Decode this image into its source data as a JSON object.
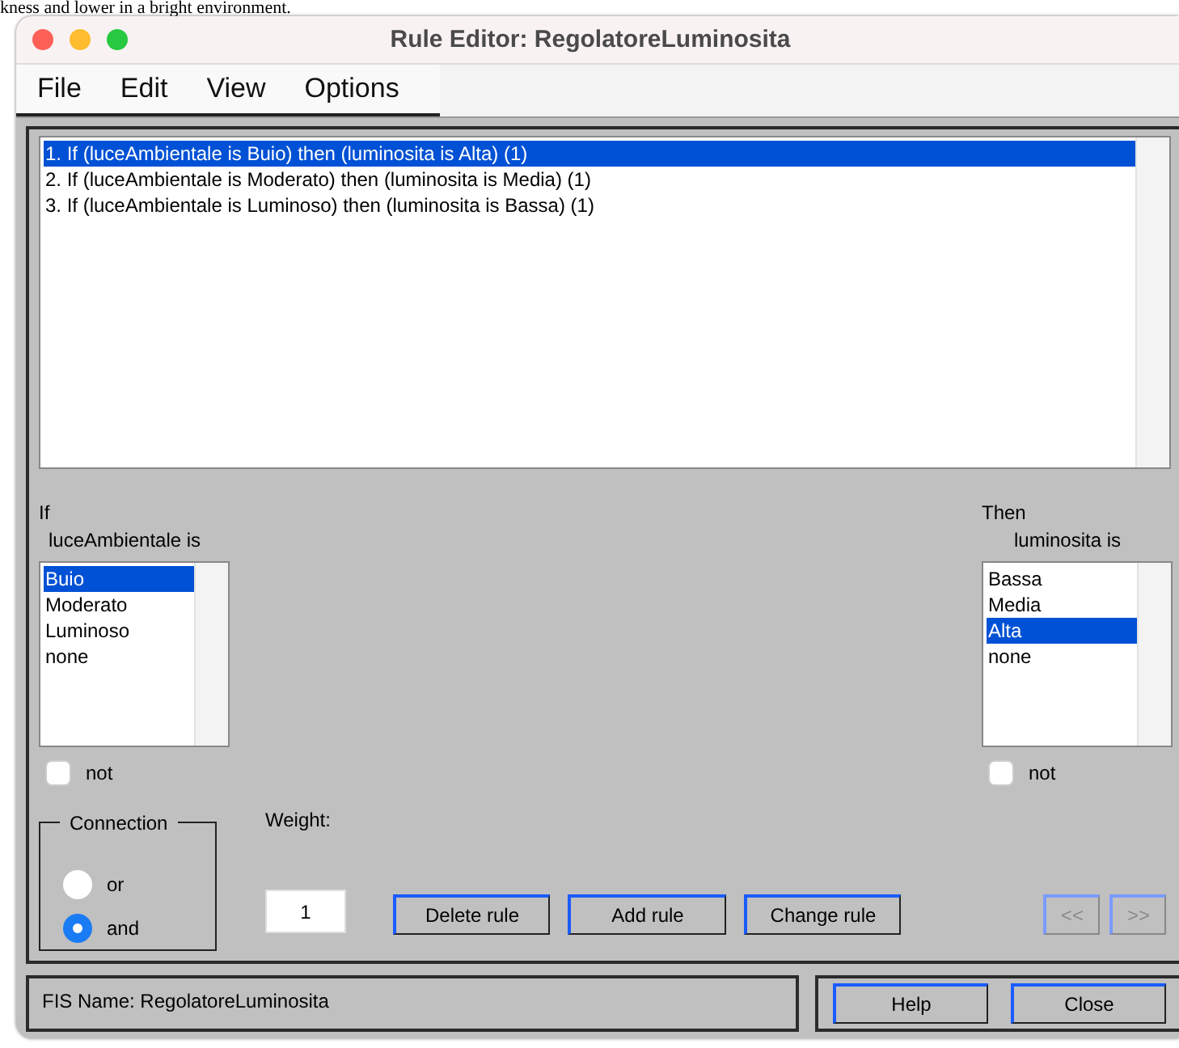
{
  "background_text": "kness and lower in a bright environment.",
  "window": {
    "title": "Rule Editor: RegolatoreLuminosita"
  },
  "menu": [
    "File",
    "Edit",
    "View",
    "Options"
  ],
  "rules": [
    {
      "text": "1. If (luceAmbientale is Buio) then (luminosita is Alta) (1)",
      "selected": true
    },
    {
      "text": "2. If (luceAmbientale is Moderato) then (luminosita is Media) (1)",
      "selected": false
    },
    {
      "text": "3. If (luceAmbientale is Luminoso) then (luminosita is Bassa) (1)",
      "selected": false
    }
  ],
  "if_section": {
    "heading": "If",
    "variable_label": "luceAmbientale is",
    "options": [
      {
        "label": "Buio",
        "selected": true
      },
      {
        "label": "Moderato",
        "selected": false
      },
      {
        "label": "Luminoso",
        "selected": false
      },
      {
        "label": "none",
        "selected": false
      }
    ],
    "not": {
      "label": "not",
      "checked": false
    }
  },
  "then_section": {
    "heading": "Then",
    "variable_label": "luminosita is",
    "options": [
      {
        "label": "Bassa",
        "selected": false
      },
      {
        "label": "Media",
        "selected": false
      },
      {
        "label": "Alta",
        "selected": true
      },
      {
        "label": "none",
        "selected": false
      }
    ],
    "not": {
      "label": "not",
      "checked": false
    }
  },
  "connection": {
    "title": "Connection",
    "options": [
      {
        "label": "or",
        "selected": false
      },
      {
        "label": "and",
        "selected": true
      }
    ]
  },
  "weight": {
    "label": "Weight:",
    "value": "1"
  },
  "buttons": [
    "Delete rule",
    "Add rule",
    "Change rule"
  ],
  "nav_buttons": [
    {
      "label": "<<",
      "disabled": true
    },
    {
      "label": ">>",
      "disabled": true
    }
  ],
  "fis_name": "FIS Name: RegolatoreLuminosita",
  "footer_buttons": [
    "Help",
    "Close"
  ]
}
